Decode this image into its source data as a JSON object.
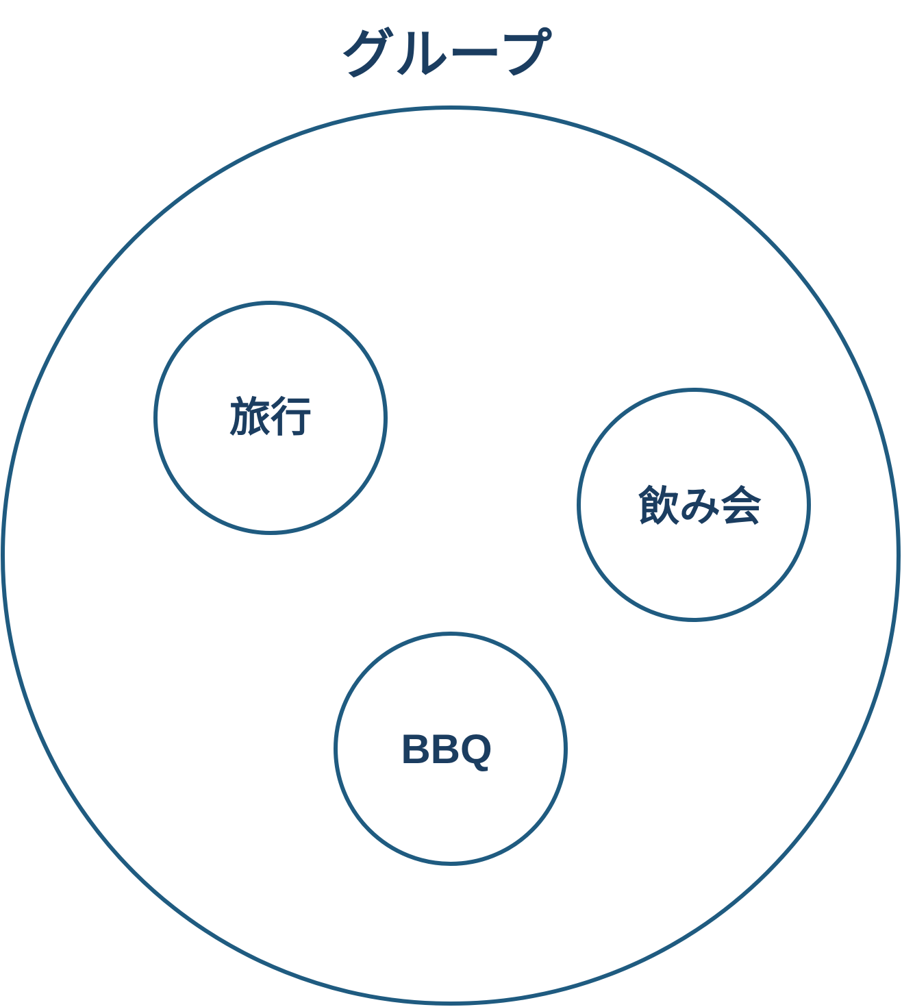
{
  "title": "グループ",
  "colors": {
    "stroke": "#1f5b80",
    "text": "#1b3d60",
    "background": "#ffffff"
  },
  "groups": [
    {
      "label": "旅行"
    },
    {
      "label": "飲み会"
    },
    {
      "label": "BBQ"
    }
  ]
}
